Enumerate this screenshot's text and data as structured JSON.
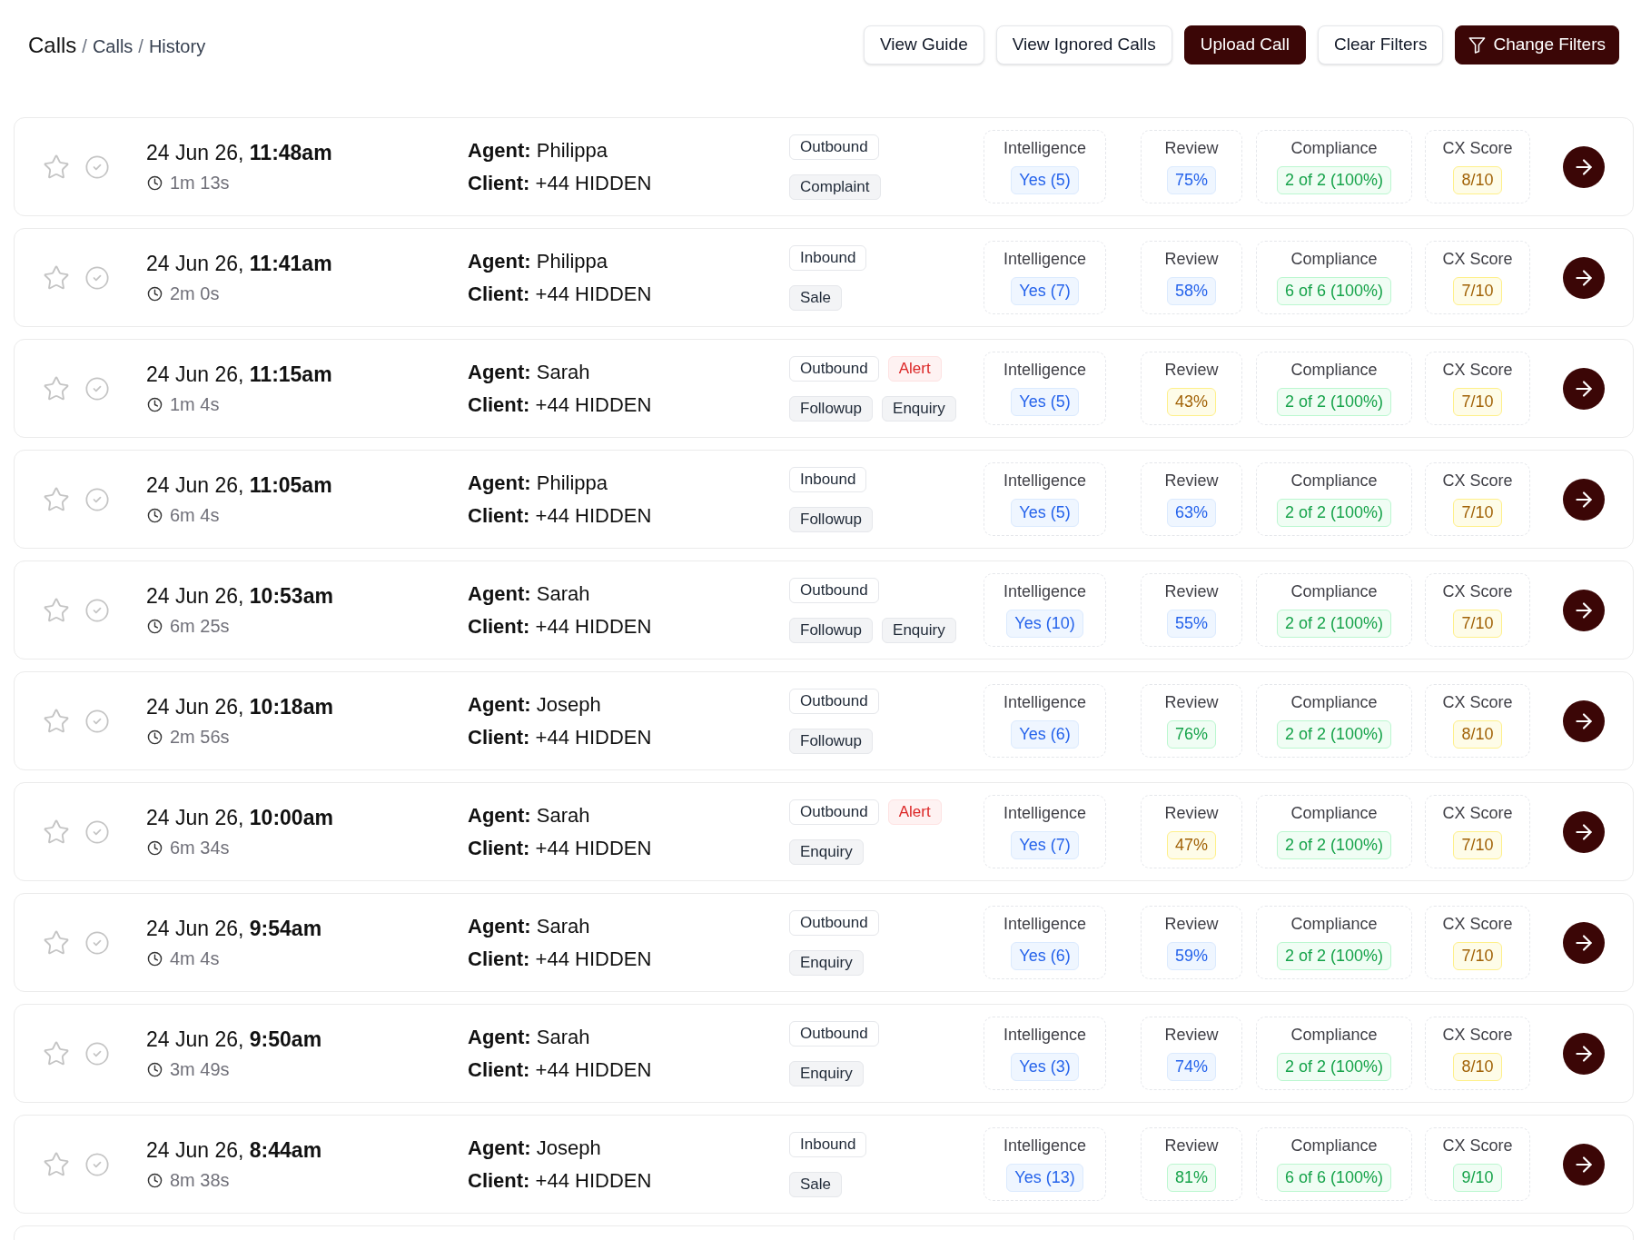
{
  "breadcrumb": [
    {
      "label": "Calls",
      "kind": "root"
    },
    {
      "label": "/",
      "kind": "separator"
    },
    {
      "label": "Calls",
      "kind": "link"
    },
    {
      "label": "/",
      "kind": "separator"
    },
    {
      "label": "History",
      "kind": "current"
    }
  ],
  "actions": [
    {
      "label": "View Guide",
      "kind": "outline"
    },
    {
      "label": "View Ignored Calls",
      "kind": "outline"
    },
    {
      "label": "Upload Call",
      "kind": "primary"
    },
    {
      "label": "Clear Filters",
      "kind": "outline"
    },
    {
      "label": "Change Filters",
      "kind": "filter"
    }
  ],
  "calls": [
    {
      "starred": false,
      "checked": false,
      "date": "24 Jun 26, **11:48am**",
      "duration": "1m 13s",
      "agent": "**Agent:** Philippa",
      "client": "**Client:** +44 HIDDEN",
      "tags": [
        {
          "label": "Outbound",
          "kind": "direction"
        },
        {
          "label": "Complaint",
          "kind": "topic"
        }
      ],
      "metrics": [
        {
          "label": "Intelligence",
          "value": "Yes (5)",
          "color": "#2563eb"
        },
        {
          "label": "Review",
          "value": "75%",
          "color": "#2563eb"
        },
        {
          "label": "Compliance",
          "value": "2 of 2 (100%)",
          "color": "#16a34a"
        },
        {
          "label": "CX Score",
          "value": "8/10",
          "color": "#a16207"
        }
      ]
    },
    {
      "starred": false,
      "checked": false,
      "date": "24 Jun 26, **11:41am**",
      "duration": "2m 0s",
      "agent": "**Agent:** Philippa",
      "client": "**Client:** +44 HIDDEN",
      "tags": [
        {
          "label": "Inbound",
          "kind": "direction"
        },
        {
          "label": "Sale",
          "kind": "topic"
        }
      ],
      "metrics": [
        {
          "label": "Intelligence",
          "value": "Yes (7)",
          "color": "#2563eb"
        },
        {
          "label": "Review",
          "value": "58%",
          "color": "#2563eb"
        },
        {
          "label": "Compliance",
          "value": "6 of 6 (100%)",
          "color": "#16a34a"
        },
        {
          "label": "CX Score",
          "value": "7/10",
          "color": "#a16207"
        }
      ]
    },
    {
      "starred": false,
      "checked": false,
      "date": "24 Jun 26, **11:15am**",
      "duration": "1m 4s",
      "agent": "**Agent:** Sarah",
      "client": "**Client:** +44 HIDDEN",
      "tags": [
        {
          "label": "Outbound",
          "kind": "direction"
        },
        {
          "label": "Alert",
          "kind": "alert"
        },
        {
          "label": "Followup",
          "kind": "topic"
        },
        {
          "label": "Enquiry",
          "kind": "topic"
        }
      ],
      "metrics": [
        {
          "label": "Intelligence",
          "value": "Yes (5)",
          "color": "#2563eb"
        },
        {
          "label": "Review",
          "value": "43%",
          "color": "#a16207"
        },
        {
          "label": "Compliance",
          "value": "2 of 2 (100%)",
          "color": "#16a34a"
        },
        {
          "label": "CX Score",
          "value": "7/10",
          "color": "#a16207"
        }
      ]
    },
    {
      "starred": false,
      "checked": false,
      "date": "24 Jun 26, **11:05am**",
      "duration": "6m 4s",
      "agent": "**Agent:** Philippa",
      "client": "**Client:** +44 HIDDEN",
      "tags": [
        {
          "label": "Inbound",
          "kind": "direction"
        },
        {
          "label": "Followup",
          "kind": "topic"
        }
      ],
      "metrics": [
        {
          "label": "Intelligence",
          "value": "Yes (5)",
          "color": "#2563eb"
        },
        {
          "label": "Review",
          "value": "63%",
          "color": "#2563eb"
        },
        {
          "label": "Compliance",
          "value": "2 of 2 (100%)",
          "color": "#16a34a"
        },
        {
          "label": "CX Score",
          "value": "7/10",
          "color": "#a16207"
        }
      ]
    },
    {
      "starred": false,
      "checked": false,
      "date": "24 Jun 26, **10:53am**",
      "duration": "6m 25s",
      "agent": "**Agent:** Sarah",
      "client": "**Client:** +44 HIDDEN",
      "tags": [
        {
          "label": "Outbound",
          "kind": "direction"
        },
        {
          "label": "Followup",
          "kind": "topic"
        },
        {
          "label": "Enquiry",
          "kind": "topic"
        }
      ],
      "metrics": [
        {
          "label": "Intelligence",
          "value": "Yes (10)",
          "color": "#2563eb"
        },
        {
          "label": "Review",
          "value": "55%",
          "color": "#2563eb"
        },
        {
          "label": "Compliance",
          "value": "2 of 2 (100%)",
          "color": "#16a34a"
        },
        {
          "label": "CX Score",
          "value": "7/10",
          "color": "#a16207"
        }
      ]
    },
    {
      "starred": false,
      "checked": false,
      "date": "24 Jun 26, **10:18am**",
      "duration": "2m 56s",
      "agent": "**Agent:** Joseph",
      "client": "**Client:** +44 HIDDEN",
      "tags": [
        {
          "label": "Outbound",
          "kind": "direction"
        },
        {
          "label": "Followup",
          "kind": "topic"
        }
      ],
      "metrics": [
        {
          "label": "Intelligence",
          "value": "Yes (6)",
          "color": "#2563eb"
        },
        {
          "label": "Review",
          "value": "76%",
          "color": "#16a34a"
        },
        {
          "label": "Compliance",
          "value": "2 of 2 (100%)",
          "color": "#16a34a"
        },
        {
          "label": "CX Score",
          "value": "8/10",
          "color": "#a16207"
        }
      ]
    },
    {
      "starred": false,
      "checked": false,
      "date": "24 Jun 26, **10:00am**",
      "duration": "6m 34s",
      "agent": "**Agent:** Sarah",
      "client": "**Client:** +44 HIDDEN",
      "tags": [
        {
          "label": "Outbound",
          "kind": "direction"
        },
        {
          "label": "Alert",
          "kind": "alert"
        },
        {
          "label": "Enquiry",
          "kind": "topic"
        }
      ],
      "metrics": [
        {
          "label": "Intelligence",
          "value": "Yes (7)",
          "color": "#2563eb"
        },
        {
          "label": "Review",
          "value": "47%",
          "color": "#a16207"
        },
        {
          "label": "Compliance",
          "value": "2 of 2 (100%)",
          "color": "#16a34a"
        },
        {
          "label": "CX Score",
          "value": "7/10",
          "color": "#a16207"
        }
      ]
    },
    {
      "starred": false,
      "checked": false,
      "date": "24 Jun 26, **9:54am**",
      "duration": "4m 4s",
      "agent": "**Agent:** Sarah",
      "client": "**Client:** +44 HIDDEN",
      "tags": [
        {
          "label": "Outbound",
          "kind": "direction"
        },
        {
          "label": "Enquiry",
          "kind": "topic"
        }
      ],
      "metrics": [
        {
          "label": "Intelligence",
          "value": "Yes (6)",
          "color": "#2563eb"
        },
        {
          "label": "Review",
          "value": "59%",
          "color": "#2563eb"
        },
        {
          "label": "Compliance",
          "value": "2 of 2 (100%)",
          "color": "#16a34a"
        },
        {
          "label": "CX Score",
          "value": "7/10",
          "color": "#a16207"
        }
      ]
    },
    {
      "starred": false,
      "checked": false,
      "date": "24 Jun 26, **9:50am**",
      "duration": "3m 49s",
      "agent": "**Agent:** Sarah",
      "client": "**Client:** +44 HIDDEN",
      "tags": [
        {
          "label": "Outbound",
          "kind": "direction"
        },
        {
          "label": "Enquiry",
          "kind": "topic"
        }
      ],
      "metrics": [
        {
          "label": "Intelligence",
          "value": "Yes (3)",
          "color": "#2563eb"
        },
        {
          "label": "Review",
          "value": "74%",
          "color": "#2563eb"
        },
        {
          "label": "Compliance",
          "value": "2 of 2 (100%)",
          "color": "#16a34a"
        },
        {
          "label": "CX Score",
          "value": "8/10",
          "color": "#a16207"
        }
      ]
    },
    {
      "starred": false,
      "checked": false,
      "date": "24 Jun 26, **8:44am**",
      "duration": "8m 38s",
      "agent": "**Agent:** Joseph",
      "client": "**Client:** +44 HIDDEN",
      "tags": [
        {
          "label": "Inbound",
          "kind": "direction"
        },
        {
          "label": "Sale",
          "kind": "topic"
        }
      ],
      "metrics": [
        {
          "label": "Intelligence",
          "value": "Yes (13)",
          "color": "#2563eb"
        },
        {
          "label": "Review",
          "value": "81%",
          "color": "#16a34a"
        },
        {
          "label": "Compliance",
          "value": "6 of 6 (100%)",
          "color": "#16a34a"
        },
        {
          "label": "CX Score",
          "value": "9/10",
          "color": "#16a34a"
        }
      ]
    }
  ]
}
